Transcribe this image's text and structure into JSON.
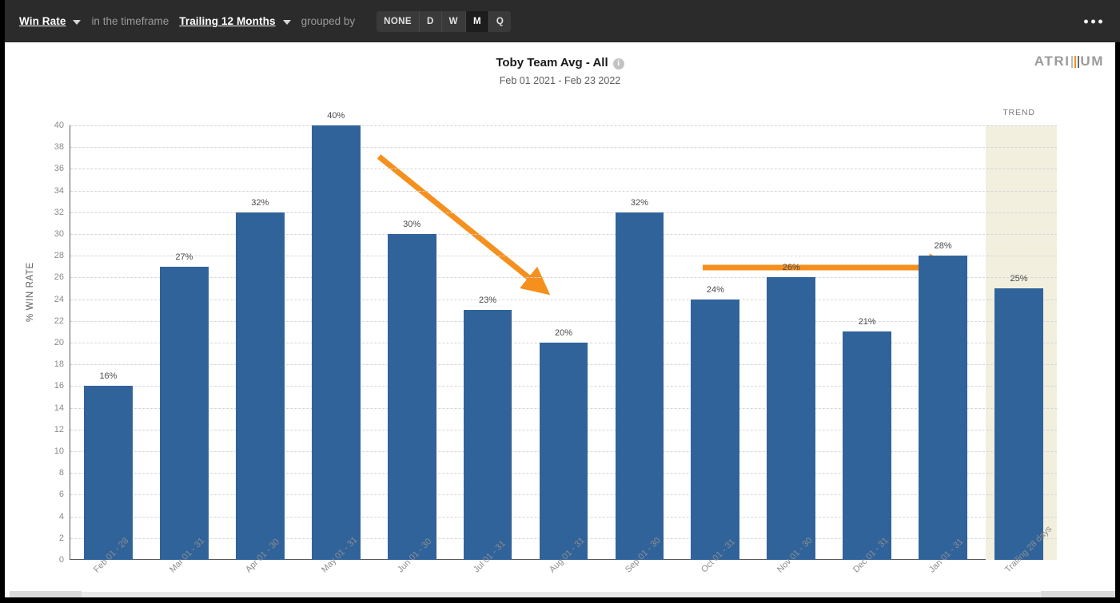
{
  "toolbar": {
    "metric_label": "Win Rate",
    "timeframe_prefix": "in the timeframe",
    "timeframe_label": "Trailing 12 Months",
    "grouped_by_label": "grouped by",
    "group_options": [
      "NONE",
      "D",
      "W",
      "M",
      "Q"
    ],
    "group_selected": "M",
    "overflow_label": "•••"
  },
  "panel": {
    "title": "Toby Team Avg - All",
    "info_glyph": "i",
    "subtitle": "Feb 01 2021 - Feb 23 2022",
    "brand_left": "ATRI",
    "brand_right": "UM",
    "brand_colors": [
      "#bdbdbd",
      "#f5901e",
      "#6b6b6b"
    ]
  },
  "colors": {
    "bar": "#31639b",
    "arrow": "#f5901e",
    "trend_band": "#f2efdf",
    "toolbar_bg": "#2b2b2b",
    "grid": "#d6d6d6"
  },
  "chart_data": {
    "type": "bar",
    "title": "Toby Team Avg - All",
    "subtitle": "Feb 01 2021 - Feb 23 2022",
    "xlabel": "",
    "ylabel": "% WIN RATE",
    "ylim": [
      0,
      40
    ],
    "ytick_step": 2,
    "yticks": [
      0,
      2,
      4,
      6,
      8,
      10,
      12,
      14,
      16,
      18,
      20,
      22,
      24,
      26,
      28,
      30,
      32,
      34,
      36,
      38,
      40
    ],
    "grid": true,
    "legend": "none",
    "categories": [
      "Feb 01 - 28",
      "Mar 01 - 31",
      "Apr 01 - 30",
      "May 01 - 31",
      "Jun 01 - 30",
      "Jul 01 - 31",
      "Aug 01 - 31",
      "Sep 01 - 30",
      "Oct 01 - 31",
      "Nov 01 - 30",
      "Dec 01 - 31",
      "Jan 01 - 31",
      "Trailing 28 days"
    ],
    "values": [
      16,
      27,
      32,
      40,
      30,
      23,
      20,
      32,
      24,
      26,
      21,
      28,
      25
    ],
    "data_labels": [
      "16%",
      "27%",
      "32%",
      "40%",
      "30%",
      "23%",
      "20%",
      "32%",
      "24%",
      "26%",
      "21%",
      "28%",
      "25%"
    ],
    "trend_region": {
      "label": "TREND",
      "category": "Trailing 28 days"
    },
    "annotations": [
      {
        "name": "declining-trend-arrow",
        "shape": "arrow",
        "direction": "down-right",
        "color": "#f5901e"
      },
      {
        "name": "flat-trend-arrow",
        "shape": "arrow",
        "direction": "right",
        "color": "#f5901e"
      }
    ]
  }
}
